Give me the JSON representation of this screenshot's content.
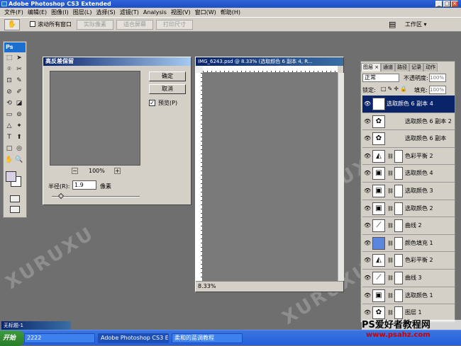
{
  "window": {
    "title": "Adobe Photoshop CS3 Extended"
  },
  "menu": [
    "文件(F)",
    "编辑(E)",
    "图像(I)",
    "图层(L)",
    "选择(S)",
    "滤镜(T)",
    "Analysis",
    "视图(V)",
    "窗口(W)",
    "帮助(H)"
  ],
  "options": {
    "all_windows": "滚动所有窗口",
    "actual_pixels": "实际像素",
    "fit_screen": "适合屏幕",
    "print_size": "打印尺寸",
    "workspace": "工作区 ▾"
  },
  "toolbox": {
    "logo": "Ps"
  },
  "dialog": {
    "title": "高反差保留",
    "ok": "确定",
    "cancel": "取消",
    "preview": "预览(P)",
    "zoom": "100%",
    "radius_label": "半径(R):",
    "radius_value": "1.9",
    "unit": "像素"
  },
  "document": {
    "title": "IMG_6243.psd @ 8.33% (选取颜色 6 副本 4, R...",
    "zoom": "8.33%"
  },
  "layers_panel": {
    "tabs": [
      "图层 ×",
      "通道",
      "路径",
      "记录",
      "动作"
    ],
    "blend_mode": "正常",
    "opacity_label": "不透明度:",
    "opacity": "100%",
    "lock_label": "锁定:",
    "fill_label": "填充:",
    "fill": "100%",
    "layers": [
      {
        "name": "选取颜色 6 副本 4",
        "selected": true,
        "thumb": "✿",
        "mask": false
      },
      {
        "name": "选取颜色 6 副本 2",
        "selected": false,
        "thumb": "✿",
        "mask": false
      },
      {
        "name": "选取颜色 6 副本",
        "selected": false,
        "thumb": "✿",
        "mask": false
      },
      {
        "name": "色彩平衡 2",
        "selected": false,
        "thumb": "◭",
        "mask": true
      },
      {
        "name": "选取颜色 4",
        "selected": false,
        "thumb": "▣",
        "mask": true
      },
      {
        "name": "选取颜色 3",
        "selected": false,
        "thumb": "▣",
        "mask": true
      },
      {
        "name": "选取颜色 2",
        "selected": false,
        "thumb": "▣",
        "mask": true
      },
      {
        "name": "曲线 2",
        "selected": false,
        "thumb": "⟋",
        "mask": true
      },
      {
        "name": "颜色填充 1",
        "selected": false,
        "thumb": "■",
        "mask": true
      },
      {
        "name": "色彩平衡 2",
        "selected": false,
        "thumb": "◭",
        "mask": true
      },
      {
        "name": "曲线 3",
        "selected": false,
        "thumb": "⟋",
        "mask": true
      },
      {
        "name": "选取颜色 1",
        "selected": false,
        "thumb": "▣",
        "mask": true
      },
      {
        "name": "图层 1",
        "selected": false,
        "thumb": "✿",
        "mask": true
      }
    ]
  },
  "taskbar": {
    "start": "开始",
    "items": [
      "2222",
      "Adobe Photoshop CS3 E...",
      "柔和的蓝调教程"
    ]
  },
  "minimized": "无标题-1",
  "watermark": {
    "text": "XURUXU",
    "site": "PS爱好者教程网",
    "url": "www.psahz.com"
  }
}
